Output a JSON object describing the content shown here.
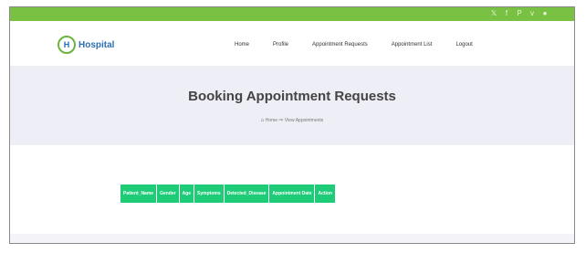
{
  "social_icons": [
    "twitter-icon",
    "facebook-icon",
    "pinterest-icon",
    "vimeo-icon",
    "dribbble-icon"
  ],
  "logo": {
    "mark": "H",
    "text": "Hospital"
  },
  "nav": [
    "Home",
    "Profile",
    "Appointment Requests",
    "Appointment List",
    "Logout"
  ],
  "hero": {
    "title": "Booking Appointment Requests",
    "breadcrumb": [
      "Home",
      "View Appointments"
    ]
  },
  "table": {
    "headers": [
      "Patient_Name",
      "Gender",
      "Age",
      "Symptoms",
      "Detected_Disease",
      "Appointment Date",
      "Action"
    ]
  },
  "colors": {
    "topbar": "#79c143",
    "table_header": "#1ecb76",
    "hero_bg": "#eeeef6",
    "logo_text": "#2d6fb4"
  }
}
